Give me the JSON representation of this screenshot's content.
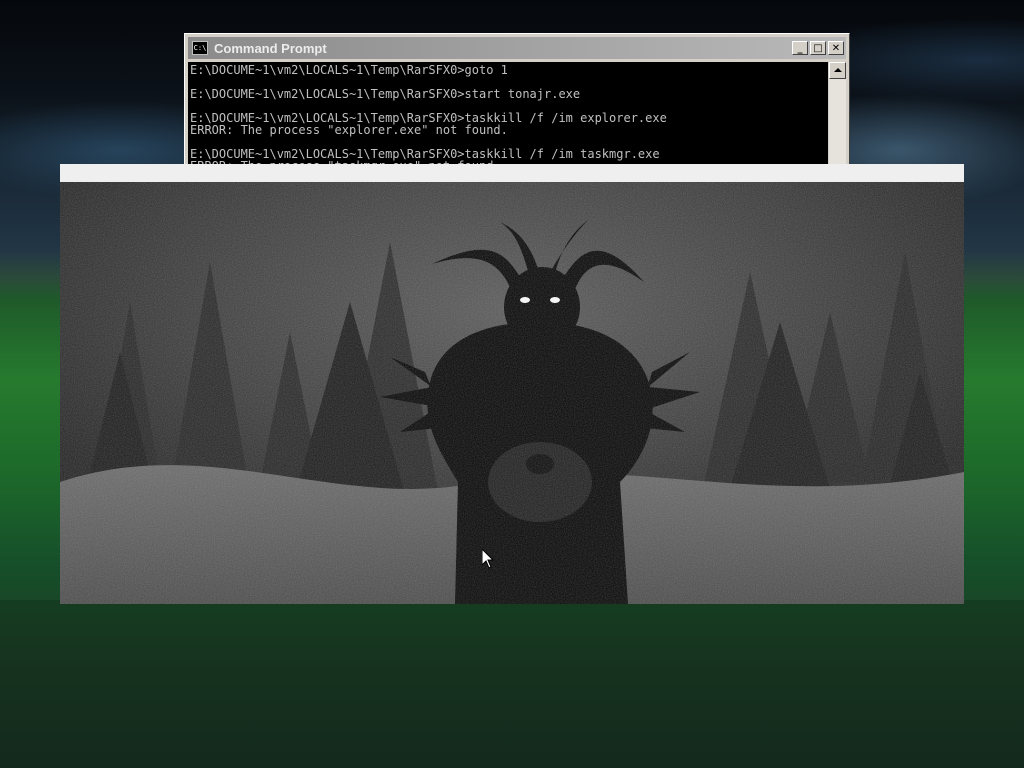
{
  "desktop": {
    "wallpaper": "night-grass-hill-wallpaper"
  },
  "cmd_window": {
    "title": "Command Prompt",
    "icon": "console-icon",
    "icon_text": "C:\\",
    "buttons": {
      "minimize": "_",
      "maximize": "□",
      "close": "✕"
    },
    "lines": [
      "E:\\DOCUME~1\\vm2\\LOCALS~1\\Temp\\RarSFX0>goto 1",
      "",
      "E:\\DOCUME~1\\vm2\\LOCALS~1\\Temp\\RarSFX0>start tonajr.exe",
      "",
      "E:\\DOCUME~1\\vm2\\LOCALS~1\\Temp\\RarSFX0>taskkill /f /im explorer.exe",
      "ERROR: The process \"explorer.exe\" not found.",
      "",
      "E:\\DOCUME~1\\vm2\\LOCALS~1\\Temp\\RarSFX0>taskkill /f /im taskmgr.exe",
      "ERROR: The process \"taskmgr.exe\" not found."
    ]
  },
  "image_window": {
    "image": "horned-creature-in-snowy-forest",
    "colors": {
      "eyes": "#ffffff",
      "creature": "#050505",
      "background": "#3a3a3a"
    }
  },
  "cursor": {
    "icon": "arrow-cursor-icon"
  }
}
